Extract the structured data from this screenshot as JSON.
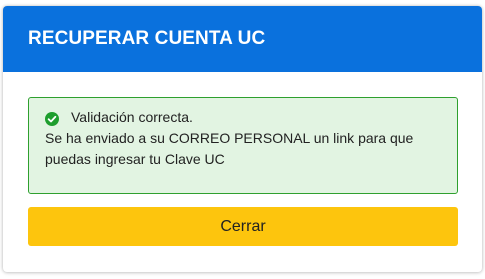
{
  "dialog": {
    "title": "RECUPERAR CUENTA UC",
    "header_color": "#0a71dd"
  },
  "alert": {
    "icon": "check-circle-icon",
    "heading": "Validación correcta.",
    "message": "Se ha enviado a su CORREO PERSONAL un link para que puedas ingresar tu Clave UC",
    "status_color": "#2ea02e",
    "background_color": "#e2f4e2"
  },
  "actions": {
    "close_label": "Cerrar",
    "close_color": "#fdc50d"
  }
}
